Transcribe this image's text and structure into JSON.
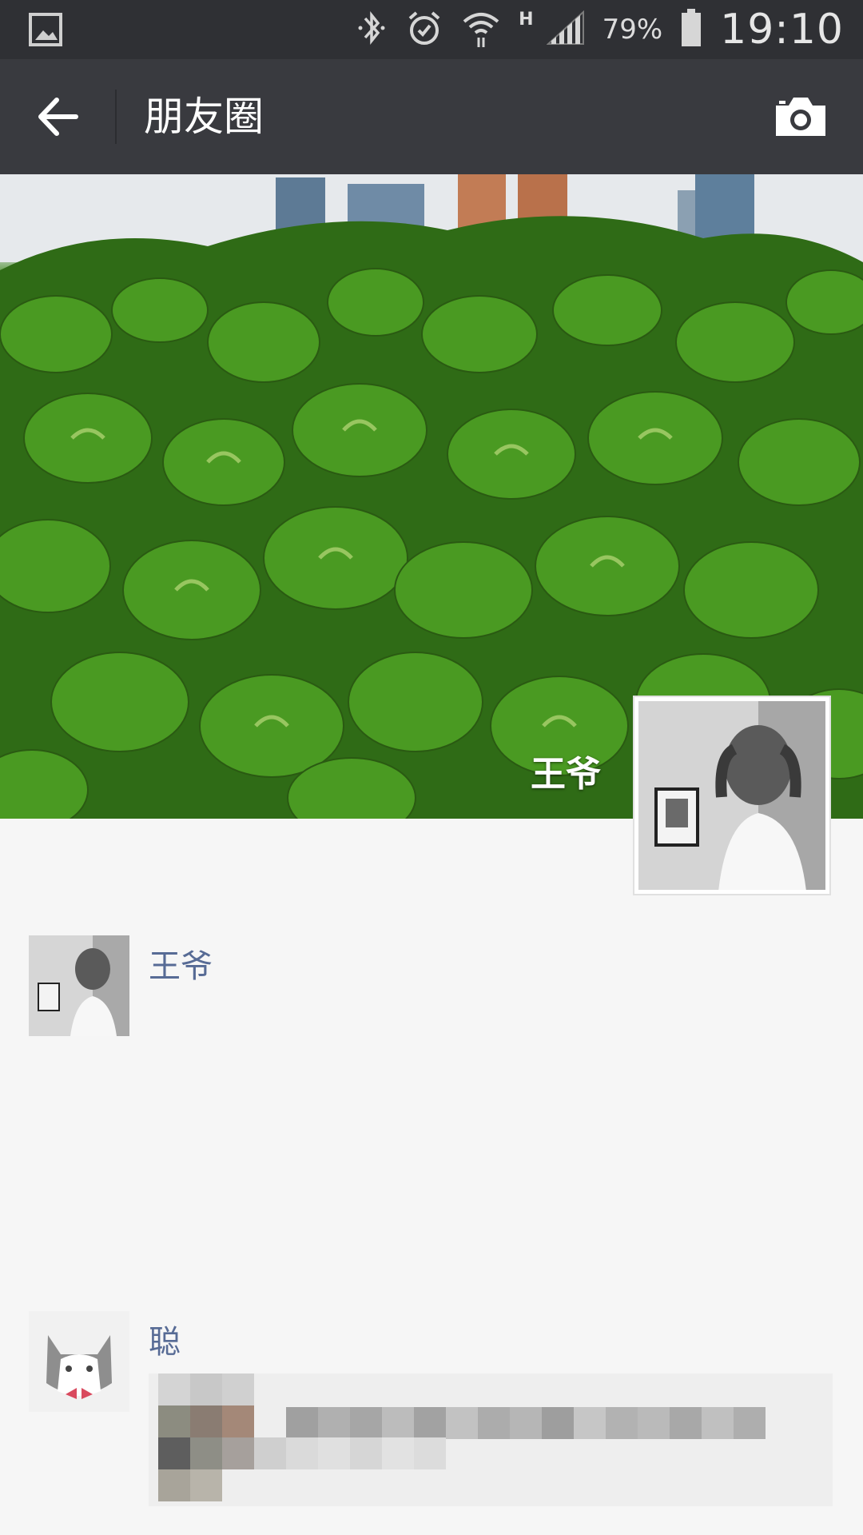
{
  "status_bar": {
    "battery": "79%",
    "time": "19:10",
    "network_type": "H",
    "icons": [
      "gallery-icon",
      "bluetooth-icon",
      "alarm-icon",
      "wifi-icon",
      "signal-icon",
      "battery-icon"
    ]
  },
  "title_bar": {
    "title": "朋友圈",
    "back_icon": "back-arrow-icon",
    "camera_icon": "camera-icon"
  },
  "cover": {
    "user_name": "王爷"
  },
  "feed": [
    {
      "name": "王爷"
    },
    {
      "name": "聪"
    }
  ],
  "colors": {
    "status_bar": "#2f3034",
    "title_bar": "#393a3f",
    "name_link": "#576b95",
    "background": "#f6f6f6"
  }
}
